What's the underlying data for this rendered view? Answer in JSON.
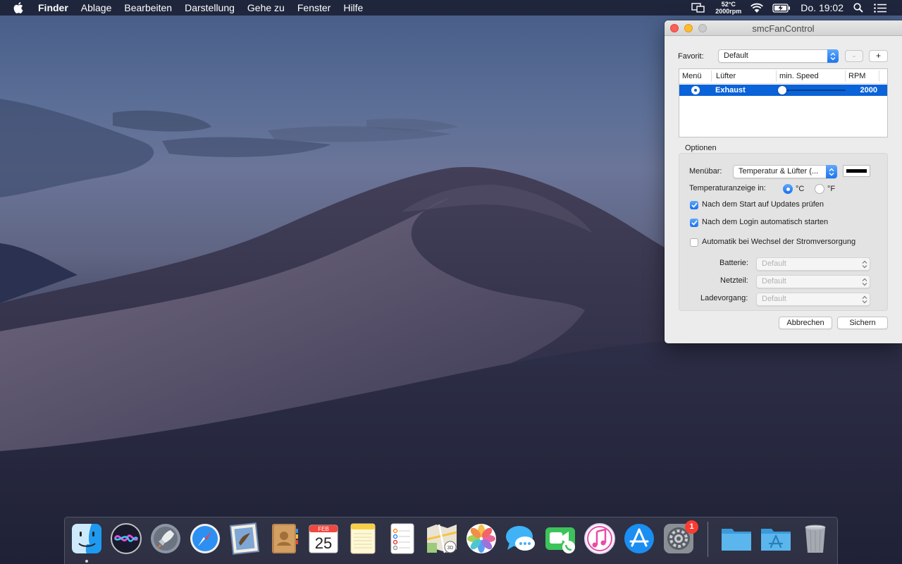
{
  "menubar": {
    "app": "Finder",
    "items": [
      "Ablage",
      "Bearbeiten",
      "Darstellung",
      "Gehe zu",
      "Fenster",
      "Hilfe"
    ],
    "fan_temp": "52°C",
    "fan_rpm": "2000rpm",
    "clock": "Do. 19:02",
    "status_icons": [
      "display-icon",
      "wifi-icon",
      "battery-charging-icon",
      "search-icon",
      "list-icon"
    ]
  },
  "window": {
    "title": "smcFanControl",
    "favorite_label": "Favorit:",
    "favorite_value": "Default",
    "minus_label": "-",
    "plus_label": "+",
    "table": {
      "headers": [
        "Menü",
        "Lüfter",
        "min. Speed",
        "RPM"
      ],
      "rows": [
        {
          "menu_selected": true,
          "fan": "Exhaust",
          "min_speed_fraction": 0.0,
          "rpm": "2000"
        }
      ]
    },
    "options_title": "Optionen",
    "menubar_label": "Menübar:",
    "menubar_value": "Temperatur & Lüfter (...",
    "menubar_color": "#000000",
    "temp_label": "Temperaturanzeige in:",
    "unit_c": "°C",
    "unit_f": "°F",
    "unit_selected": "°C",
    "check_updates": "Nach dem Start auf Updates prüfen",
    "check_login": "Nach dem Login automatisch starten",
    "check_power": "Automatik bei Wechsel der Stromversorgung",
    "check_updates_on": true,
    "check_login_on": true,
    "check_power_on": false,
    "battery_label": "Batterie:",
    "battery_value": "Default",
    "ac_label": "Netzteil:",
    "ac_value": "Default",
    "charging_label": "Ladevorgang:",
    "charging_value": "Default",
    "cancel_label": "Abbrechen",
    "save_label": "Sichern"
  },
  "dock": {
    "apps": [
      "finder-icon",
      "siri-icon",
      "launchpad-icon",
      "safari-icon",
      "mail-icon",
      "contacts-icon",
      "calendar-icon",
      "notes-icon",
      "reminders-icon",
      "maps-icon",
      "photos-icon",
      "messages-icon",
      "facetime-icon",
      "itunes-icon",
      "app-store-icon",
      "system-preferences-icon",
      "folder-icon",
      "applications-folder-icon",
      "trash-icon"
    ],
    "calendar_month": "FEB",
    "calendar_day": "25",
    "maps_badge": "3D",
    "sysprefs_badge": "1"
  }
}
